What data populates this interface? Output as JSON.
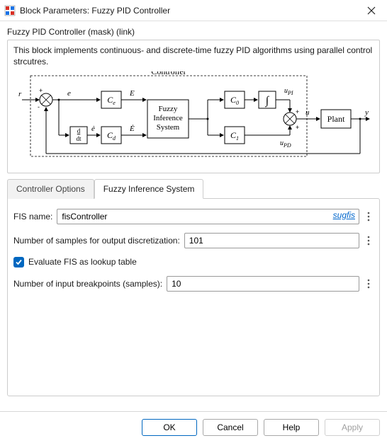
{
  "window": {
    "title": "Block Parameters: Fuzzy PID Controller"
  },
  "mask": {
    "title": "Fuzzy PID Controller (mask) (link)",
    "description": "This block implements continuous- and discrete-time fuzzy PID algorithms using parallel control strcutres."
  },
  "diagram": {
    "title": "Controller",
    "labels": {
      "r": "r",
      "e": "e",
      "edot": "ė",
      "E": "E",
      "Edot": "Ė",
      "Ce": "Cₑ",
      "Cd": "C_d",
      "ddt": "d/dt",
      "fuzzy1": "Fuzzy",
      "fuzzy2": "Inference",
      "fuzzy3": "System",
      "C0": "C₀",
      "C1": "C₁",
      "integ": "∫",
      "upi": "u_PI",
      "upd": "u_PD",
      "u": "u",
      "plant": "Plant",
      "y": "y",
      "plus": "+",
      "minus": "-"
    }
  },
  "tabs": {
    "t0": "Controller Options",
    "t1": "Fuzzy Inference System",
    "active": 1
  },
  "fields": {
    "fis_name_label": "FIS name:",
    "fis_name_value": "fisController",
    "fis_name_link": "sugfis",
    "num_samples_label": "Number of samples for output discretization:",
    "num_samples_value": "101",
    "lookup_label": "Evaluate FIS as lookup table",
    "lookup_checked": true,
    "breakpoints_label": "Number of input breakpoints (samples):",
    "breakpoints_value": "10"
  },
  "buttons": {
    "ok": "OK",
    "cancel": "Cancel",
    "help": "Help",
    "apply": "Apply"
  }
}
